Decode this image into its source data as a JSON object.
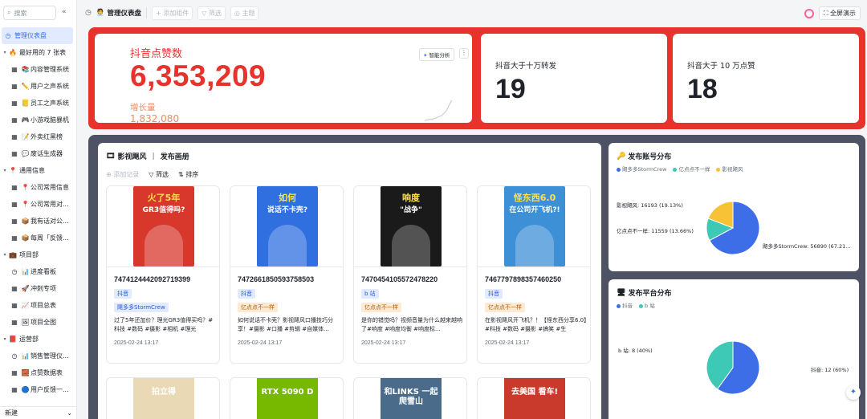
{
  "sidebar": {
    "search_placeholder": "搜索",
    "collapse": "«",
    "items": [
      {
        "level": 0,
        "icon": "◷",
        "label": "管理仪表盘",
        "active": true
      },
      {
        "level": 0,
        "caret": "▾",
        "icon": "🔥",
        "label": "最好用的 7 张表"
      },
      {
        "level": 1,
        "icon": "▦",
        "icon2": "📚",
        "label": "内容管理系统"
      },
      {
        "level": 1,
        "icon": "▦",
        "icon2": "✏️",
        "label": "用户之声系统"
      },
      {
        "level": 1,
        "icon": "▦",
        "icon2": "📒",
        "label": "员工之声系统"
      },
      {
        "level": 1,
        "icon": "▦",
        "icon2": "🎮",
        "label": "小游戏脑暴机"
      },
      {
        "level": 1,
        "icon": "▦",
        "icon2": "📝",
        "label": "外卖红黑榜"
      },
      {
        "level": 1,
        "icon": "▦",
        "icon2": "💬",
        "label": "废话生成器"
      },
      {
        "level": 0,
        "caret": "▾",
        "icon": "📍",
        "label": "通用信息"
      },
      {
        "level": 1,
        "icon": "▦",
        "icon2": "📍",
        "label": "公司常用信息"
      },
      {
        "level": 1,
        "icon": "▦",
        "icon2": "📍",
        "label": "公司常用对..."
      },
      {
        "level": 1,
        "icon": "▦",
        "icon2": "📦",
        "label": "我有话对公..."
      },
      {
        "level": 1,
        "icon": "▦",
        "icon2": "📦",
        "label": "每周「反馈..."
      },
      {
        "level": 0,
        "caret": "▾",
        "icon": "💼",
        "label": "项目部"
      },
      {
        "level": 1,
        "icon": "◷",
        "icon2": "📊",
        "label": "进度看板"
      },
      {
        "level": 1,
        "icon": "▦",
        "icon2": "🚀",
        "label": "冲刺专项"
      },
      {
        "level": 1,
        "icon": "▦",
        "icon2": "📈",
        "label": "项目总表"
      },
      {
        "level": 1,
        "icon": "▦",
        "icon2": "🖼",
        "label": "项目全图"
      },
      {
        "level": 0,
        "caret": "▾",
        "icon": "📕",
        "label": "运营部"
      },
      {
        "level": 1,
        "icon": "◷",
        "icon2": "📊",
        "label": "销售管理仪..."
      },
      {
        "level": 1,
        "icon": "▦",
        "icon2": "🧱",
        "label": "点赞数据表"
      },
      {
        "level": 1,
        "icon": "▦",
        "icon2": "🔵",
        "label": "用户反馈一..."
      }
    ],
    "footer_new": "新建",
    "footer_more": "⌄"
  },
  "topbar": {
    "title": "管理仪表盘",
    "tools": [
      "+ 添加组件",
      "▽ 筛选",
      "◎ 主题"
    ],
    "fullscreen": "全屏演示"
  },
  "kpi": {
    "main_label": "抖音点赞数",
    "main_value": "6,353,209",
    "growth_label": "增长量",
    "growth_value": "1,832,080",
    "ai_btn": "智能分析",
    "more_btn": "⋮",
    "card2_label": "抖音大于十万转发",
    "card2_value": "19",
    "card3_label": "抖音大于 10 万点赞",
    "card3_value": "18"
  },
  "gallery": {
    "title_left": "影视飓风",
    "title_sep": "|",
    "title_right": "发布画册",
    "tools": [
      "⊕ 添加记录",
      "▽ 筛选",
      "⇅ 排序"
    ],
    "cards": [
      {
        "id": "7474124442092719399",
        "tag1": "抖音",
        "tag2": "飓多多StormCrew",
        "tag2_color": "blue",
        "desc": "过了5年还加价？理光GR3值得买吗？#科技 #数码 #摄影 #相机 #理光",
        "date": "2025-02-24  13:17",
        "cover_text1": "火了5年",
        "cover_text2": "GR3值得吗?",
        "cover_bg": "#d8372c"
      },
      {
        "id": "7472661850593758503",
        "tag1": "抖音",
        "tag2": "亿点点不一样",
        "tag2_color": "orange",
        "desc": "如何说话不卡壳？影视飓风口播技巧分享！#摄影 #口播 #剪辑 #自媒体...",
        "date": "2025-02-24  13:17",
        "cover_text1": "如何",
        "cover_text2": "说话不卡壳?",
        "cover_bg": "#2f6fe0"
      },
      {
        "id": "7470454105572478220",
        "tag1": "b 站",
        "tag2": "亿点点不一样",
        "tag2_color": "orange",
        "desc": "是你的错觉吗？视频音量为什么越来越响了#响度 #响度均衡 #响度标...",
        "date": "2025-02-24  13:17",
        "cover_text1": "响度",
        "cover_text2": "\"战争\"",
        "cover_bg": "#1a1a1a"
      },
      {
        "id": "7467797898357460250",
        "tag1": "抖音",
        "tag2": "亿点点不一样",
        "tag2_color": "orange",
        "desc": "在影视飓风开飞机？！【怪东西分享6.0】#科技 #数码 #摄影 #搞笑 #生",
        "date": "2025-02-24  13:17",
        "cover_text1": "怪东西6.0",
        "cover_text2": "在公司开飞机?!",
        "cover_bg": "#3d8fd6"
      }
    ],
    "row2_covers": [
      {
        "text": "拍立得",
        "bg": "#e9d9b5"
      },
      {
        "text": "RTX 5090 D",
        "bg": "#76b900"
      },
      {
        "text": "和LINKS 一起爬雪山",
        "bg": "#4a6b8a"
      },
      {
        "text": "去美国 看车!",
        "bg": "#c93a2c"
      }
    ]
  },
  "charts": {
    "account": {
      "title": "发布账号分布",
      "legend": [
        "飓多多StormCrew",
        "亿点点不一样",
        "影视飓风"
      ],
      "labels": [
        "影视飓风: 16193 (19.13%)",
        "亿点点不一样: 11559 (13.66%)",
        "飓多多StormCrew: 56890 (67.21..."
      ]
    },
    "platform": {
      "title": "发布平台分布",
      "legend": [
        "抖音",
        "b 站"
      ],
      "labels": [
        "b 站: 8 (40%)",
        "抖音: 12 (60%)"
      ]
    }
  },
  "chart_data": [
    {
      "type": "pie",
      "title": "发布账号分布",
      "categories": [
        "飓多多StormCrew",
        "亿点点不一样",
        "影视飓风"
      ],
      "values": [
        56890,
        11559,
        16193
      ],
      "colors": [
        "#3d6ee8",
        "#3ec9b6",
        "#f7c235"
      ]
    },
    {
      "type": "pie",
      "title": "发布平台分布",
      "categories": [
        "抖音",
        "b 站"
      ],
      "values": [
        12,
        8
      ],
      "colors": [
        "#3d6ee8",
        "#3ec9b6"
      ]
    }
  ],
  "colors": {
    "accent_red": "#e8322c",
    "dark_zone": "#4d5364",
    "blue": "#3370ff"
  }
}
